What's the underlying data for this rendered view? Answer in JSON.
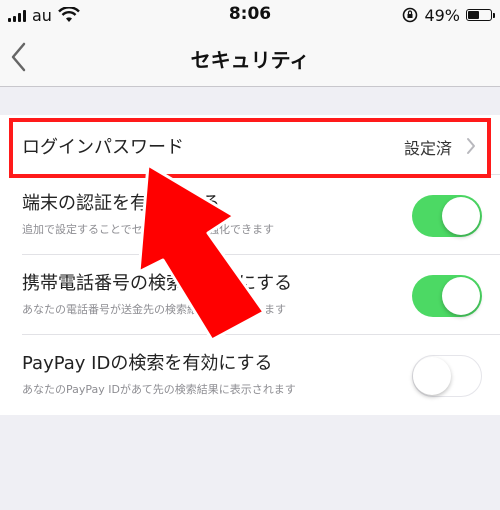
{
  "status_bar": {
    "carrier": "au",
    "time": "8:06",
    "battery_percent": "49%",
    "battery_level": 0.49
  },
  "nav": {
    "title": "セキュリティ",
    "back_icon": "chevron-left-icon"
  },
  "rows": [
    {
      "title": "ログインパスワード",
      "value": "設定済"
    },
    {
      "title": "端末の認証を有効にする",
      "subtitle": "追加で設定することでセキュリティを強化できます",
      "toggle": true
    },
    {
      "title": "携帯電話番号の検索を有効にする",
      "subtitle": "あなたの電話番号が送金先の検索結果に表示されます",
      "toggle": true
    },
    {
      "title": "PayPay IDの検索を有効にする",
      "subtitle": "あなたのPayPay IDがあて先の検索結果に表示されます",
      "toggle": false
    }
  ],
  "colors": {
    "toggle_on": "#4cd964",
    "highlight": "#ff1a1a",
    "arrow": "#ff0000"
  }
}
